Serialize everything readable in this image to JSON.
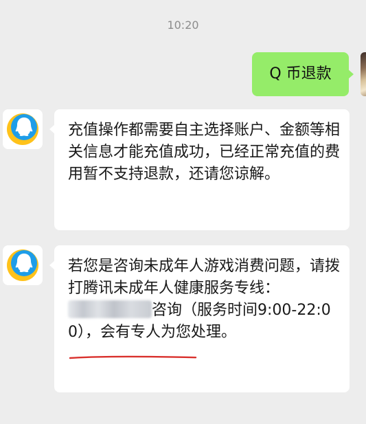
{
  "chat": {
    "timestamp": "10:20",
    "outgoing": {
      "text": "Q 币退款"
    },
    "incoming": [
      {
        "sender_icon": "qq-penguin-icon",
        "text": "充值操作都需要自主选择账户、金额等相关信息才能充值成功，已经正常充值的费用暂不支持退款，还请您谅解。"
      },
      {
        "sender_icon": "qq-penguin-icon",
        "text_before": "若您是咨询未成年人游戏消费问题，请拨打腾讯未成年人健康服务专线：",
        "text_after": "咨询（服务时间9:00-22:00），会有专人为您处理。"
      }
    ]
  },
  "colors": {
    "background": "#ededed",
    "outgoing_bubble": "#95ec69",
    "incoming_bubble": "#ffffff",
    "qq_blue": "#1e9de8",
    "qq_yellow": "#ffc21a",
    "annotation_red": "#d9302c"
  }
}
